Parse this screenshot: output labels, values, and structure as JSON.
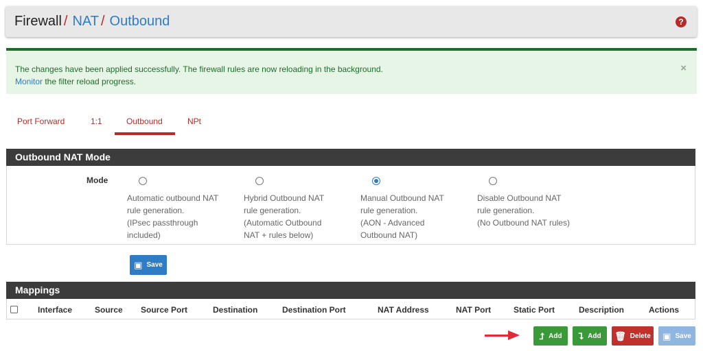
{
  "breadcrumb": {
    "root": "Firewall",
    "level1": "NAT",
    "level2": "Outbound",
    "separator": "/"
  },
  "alert": {
    "message": "The changes have been applied successfully. The firewall rules are now reloading in the background.",
    "link_text": "Monitor",
    "link_suffix": " the filter reload progress.",
    "close": "×"
  },
  "tabs": [
    {
      "label": "Port Forward",
      "active": false
    },
    {
      "label": "1:1",
      "active": false
    },
    {
      "label": "Outbound",
      "active": true
    },
    {
      "label": "NPt",
      "active": false
    }
  ],
  "nat_mode": {
    "title": "Outbound NAT Mode",
    "label": "Mode",
    "selected": "manual",
    "options": [
      {
        "key": "automatic",
        "lines": [
          "Automatic outbound NAT",
          "rule generation.",
          "(IPsec passthrough",
          "included)"
        ]
      },
      {
        "key": "hybrid",
        "lines": [
          "Hybrid Outbound NAT",
          "rule generation.",
          "(Automatic Outbound",
          "NAT + rules below)"
        ]
      },
      {
        "key": "manual",
        "lines": [
          "Manual Outbound NAT",
          "rule generation.",
          "(AON - Advanced",
          "Outbound NAT)"
        ]
      },
      {
        "key": "disable",
        "lines": [
          "Disable Outbound NAT",
          "rule generation.",
          "(No Outbound NAT rules)"
        ]
      }
    ],
    "save_label": "Save"
  },
  "mappings": {
    "title": "Mappings",
    "columns": [
      "Interface",
      "Source",
      "Source Port",
      "Destination",
      "Destination Port",
      "NAT Address",
      "NAT Port",
      "Static Port",
      "Description",
      "Actions"
    ]
  },
  "actions": {
    "add_top_label": "Add",
    "add_bottom_label": "Add",
    "delete_label": "Delete",
    "save_label": "Save"
  },
  "colors": {
    "accent": "#2e7bc6",
    "danger": "#b52b27",
    "success_text": "#1f6b2b",
    "panel_header": "#3c3c3c",
    "annotation_arrow": "#e02b36"
  }
}
